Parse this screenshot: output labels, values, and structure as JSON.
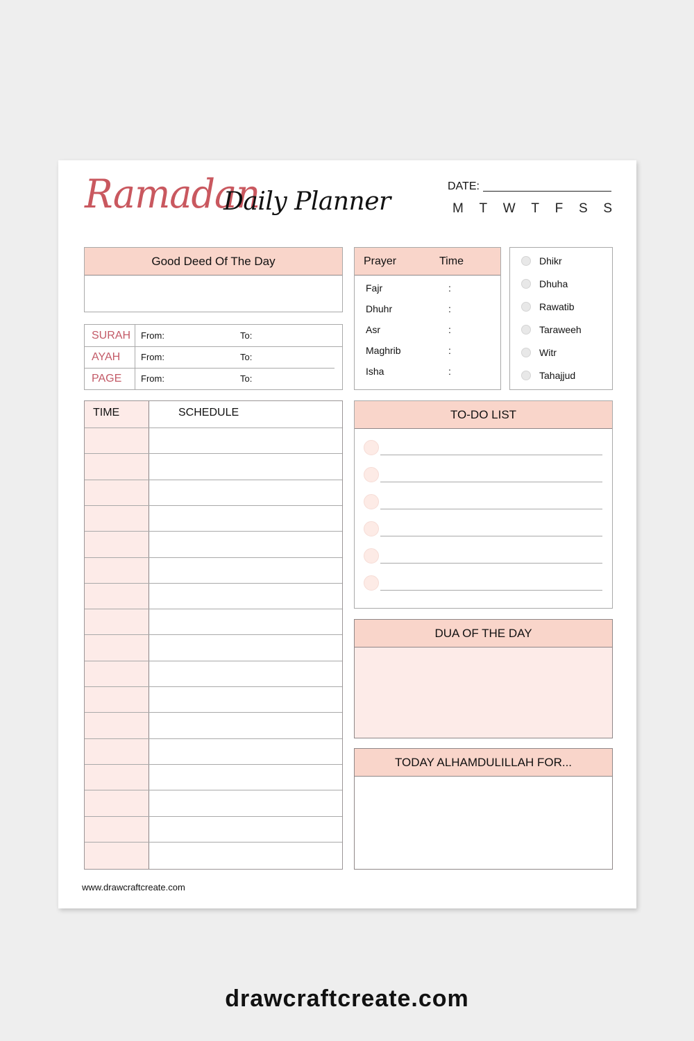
{
  "header": {
    "title_accent": "Ramadan",
    "title_rest": "Daily Planner",
    "date_label": "DATE:",
    "weekdays": [
      "M",
      "T",
      "W",
      "T",
      "F",
      "S",
      "S"
    ]
  },
  "good_deed": {
    "title": "Good Deed Of The Day"
  },
  "reading": {
    "rows": [
      {
        "label": "SURAH",
        "from": "From:",
        "to": "To:"
      },
      {
        "label": "AYAH",
        "from": "From:",
        "to": "To:"
      },
      {
        "label": "PAGE",
        "from": "From:",
        "to": "To:"
      }
    ]
  },
  "prayer": {
    "col_prayer": "Prayer",
    "col_time": "Time",
    "rows": [
      {
        "name": "Fajr",
        "time": ":"
      },
      {
        "name": "Dhuhr",
        "time": ":"
      },
      {
        "name": "Asr",
        "time": ":"
      },
      {
        "name": "Maghrib",
        "time": ":"
      },
      {
        "name": "Isha",
        "time": ":"
      }
    ]
  },
  "sunnah": {
    "items": [
      "Dhikr",
      "Dhuha",
      "Rawatib",
      "Taraweeh",
      "Witr",
      "Tahajjud"
    ]
  },
  "schedule": {
    "col_time": "TIME",
    "col_schedule": "SCHEDULE",
    "row_count": 17
  },
  "todo": {
    "title": "TO-DO LIST",
    "item_count": 6
  },
  "dua": {
    "title": "DUA OF THE DAY"
  },
  "thanks": {
    "title": "TODAY ALHAMDULILLAH FOR..."
  },
  "footer": {
    "site_small": "www.drawcraftcreate.com",
    "site_big": "drawcraftcreate.com"
  },
  "colors": {
    "accent_red": "#c9585f",
    "header_fill": "#f9d5ca",
    "light_pink": "#fdebe8",
    "background": "#eeeeee"
  }
}
